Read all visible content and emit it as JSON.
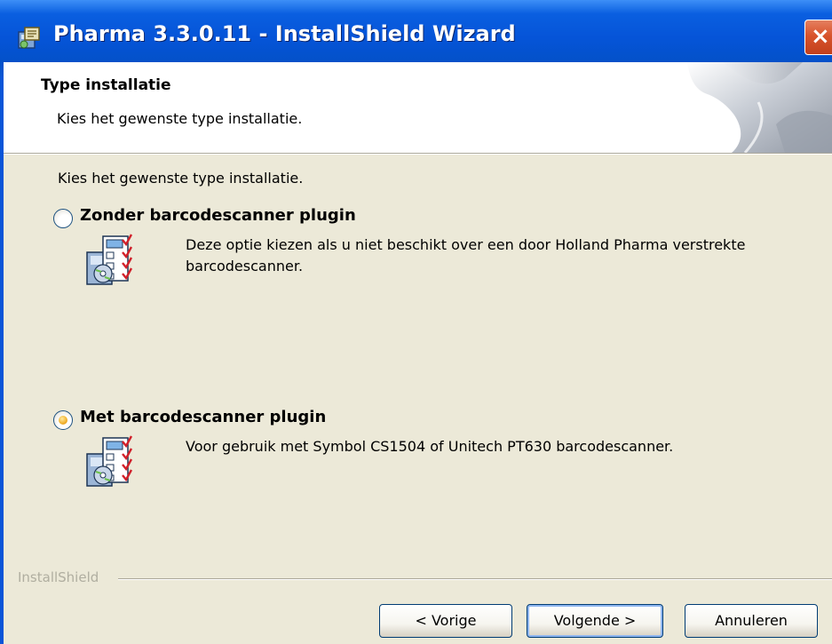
{
  "window": {
    "title": "Pharma 3.3.0.11 - InstallShield Wizard",
    "close_label": "×",
    "icon": "installer-icon"
  },
  "header": {
    "title": "Type installatie",
    "subtitle": "Kies het gewenste type installatie."
  },
  "body": {
    "intro": "Kies het gewenste type installatie.",
    "options": [
      {
        "label": "Zonder barcodescanner plugin",
        "description": "Deze optie kiezen als u niet beschikt over een door Holland Pharma verstrekte barcodescanner.",
        "selected": false,
        "icon": "setup-package-icon"
      },
      {
        "label": "Met barcodescanner plugin",
        "description": "Voor gebruik met Symbol CS1504 of Unitech PT630 barcodescanner.",
        "selected": true,
        "icon": "setup-package-icon"
      }
    ]
  },
  "footer": {
    "brand": "InstallShield",
    "back_label": "< Vorige",
    "next_label": "Volgende >",
    "cancel_label": "Annuleren"
  },
  "colors": {
    "titlebar": "#0554d8",
    "dialog_bg": "#ece9d8",
    "close_button": "#d8532c",
    "radio_selected": "#f2b534"
  }
}
